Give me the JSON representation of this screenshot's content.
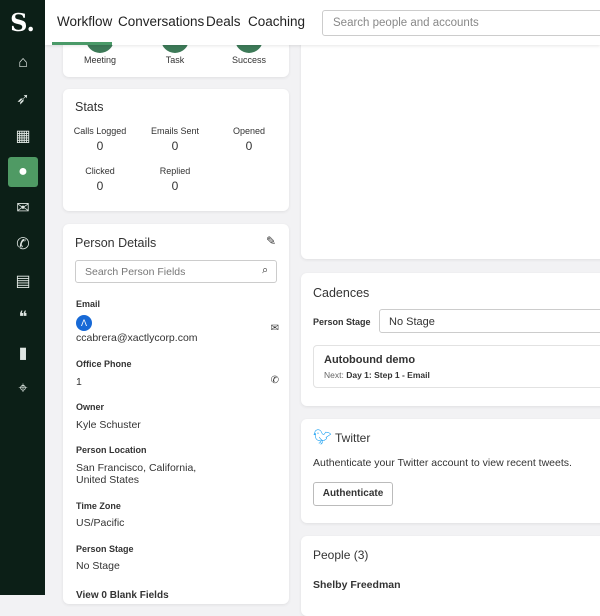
{
  "sidebar": {
    "logo": "S.",
    "items": [
      "home",
      "rocket",
      "buildings",
      "person",
      "mail",
      "phone",
      "document",
      "quote",
      "chart",
      "crosshair"
    ]
  },
  "header": {
    "tabs": [
      "Workflow",
      "Conversations",
      "Deals",
      "Coaching"
    ],
    "search_placeholder": "Search people and accounts"
  },
  "activity": {
    "labels": [
      "Meeting",
      "Task",
      "Success"
    ]
  },
  "stats": {
    "title": "Stats",
    "items": [
      {
        "label": "Calls Logged",
        "value": "0"
      },
      {
        "label": "Emails Sent",
        "value": "0"
      },
      {
        "label": "Opened",
        "value": "0"
      },
      {
        "label": "Clicked",
        "value": "0"
      },
      {
        "label": "Replied",
        "value": "0"
      }
    ]
  },
  "person_details": {
    "title": "Person Details",
    "search_placeholder": "Search Person Fields",
    "email_label": "Email",
    "email": "ccabrera@xactlycorp.com",
    "phone_label": "Office Phone",
    "phone": "1",
    "owner_label": "Owner",
    "owner": "Kyle Schuster",
    "location_label": "Person Location",
    "location_line1": "San Francisco, California,",
    "location_line2": "United States",
    "tz_label": "Time Zone",
    "tz": "US/Pacific",
    "stage_label": "Person Stage",
    "stage": "No Stage",
    "blank_fields": "View 0 Blank Fields"
  },
  "cadences": {
    "title": "Cadences",
    "stage_label": "Person Stage",
    "stage_value": "No Stage",
    "cadence_name": "Autobound demo",
    "next_prefix": "Next:",
    "next_step": "Day 1: Step 1 - Email"
  },
  "twitter": {
    "title": "Twitter",
    "text": "Authenticate your Twitter account to view recent tweets.",
    "button": "Authenticate"
  },
  "people": {
    "title": "People (3)",
    "first": "Shelby Freedman"
  }
}
